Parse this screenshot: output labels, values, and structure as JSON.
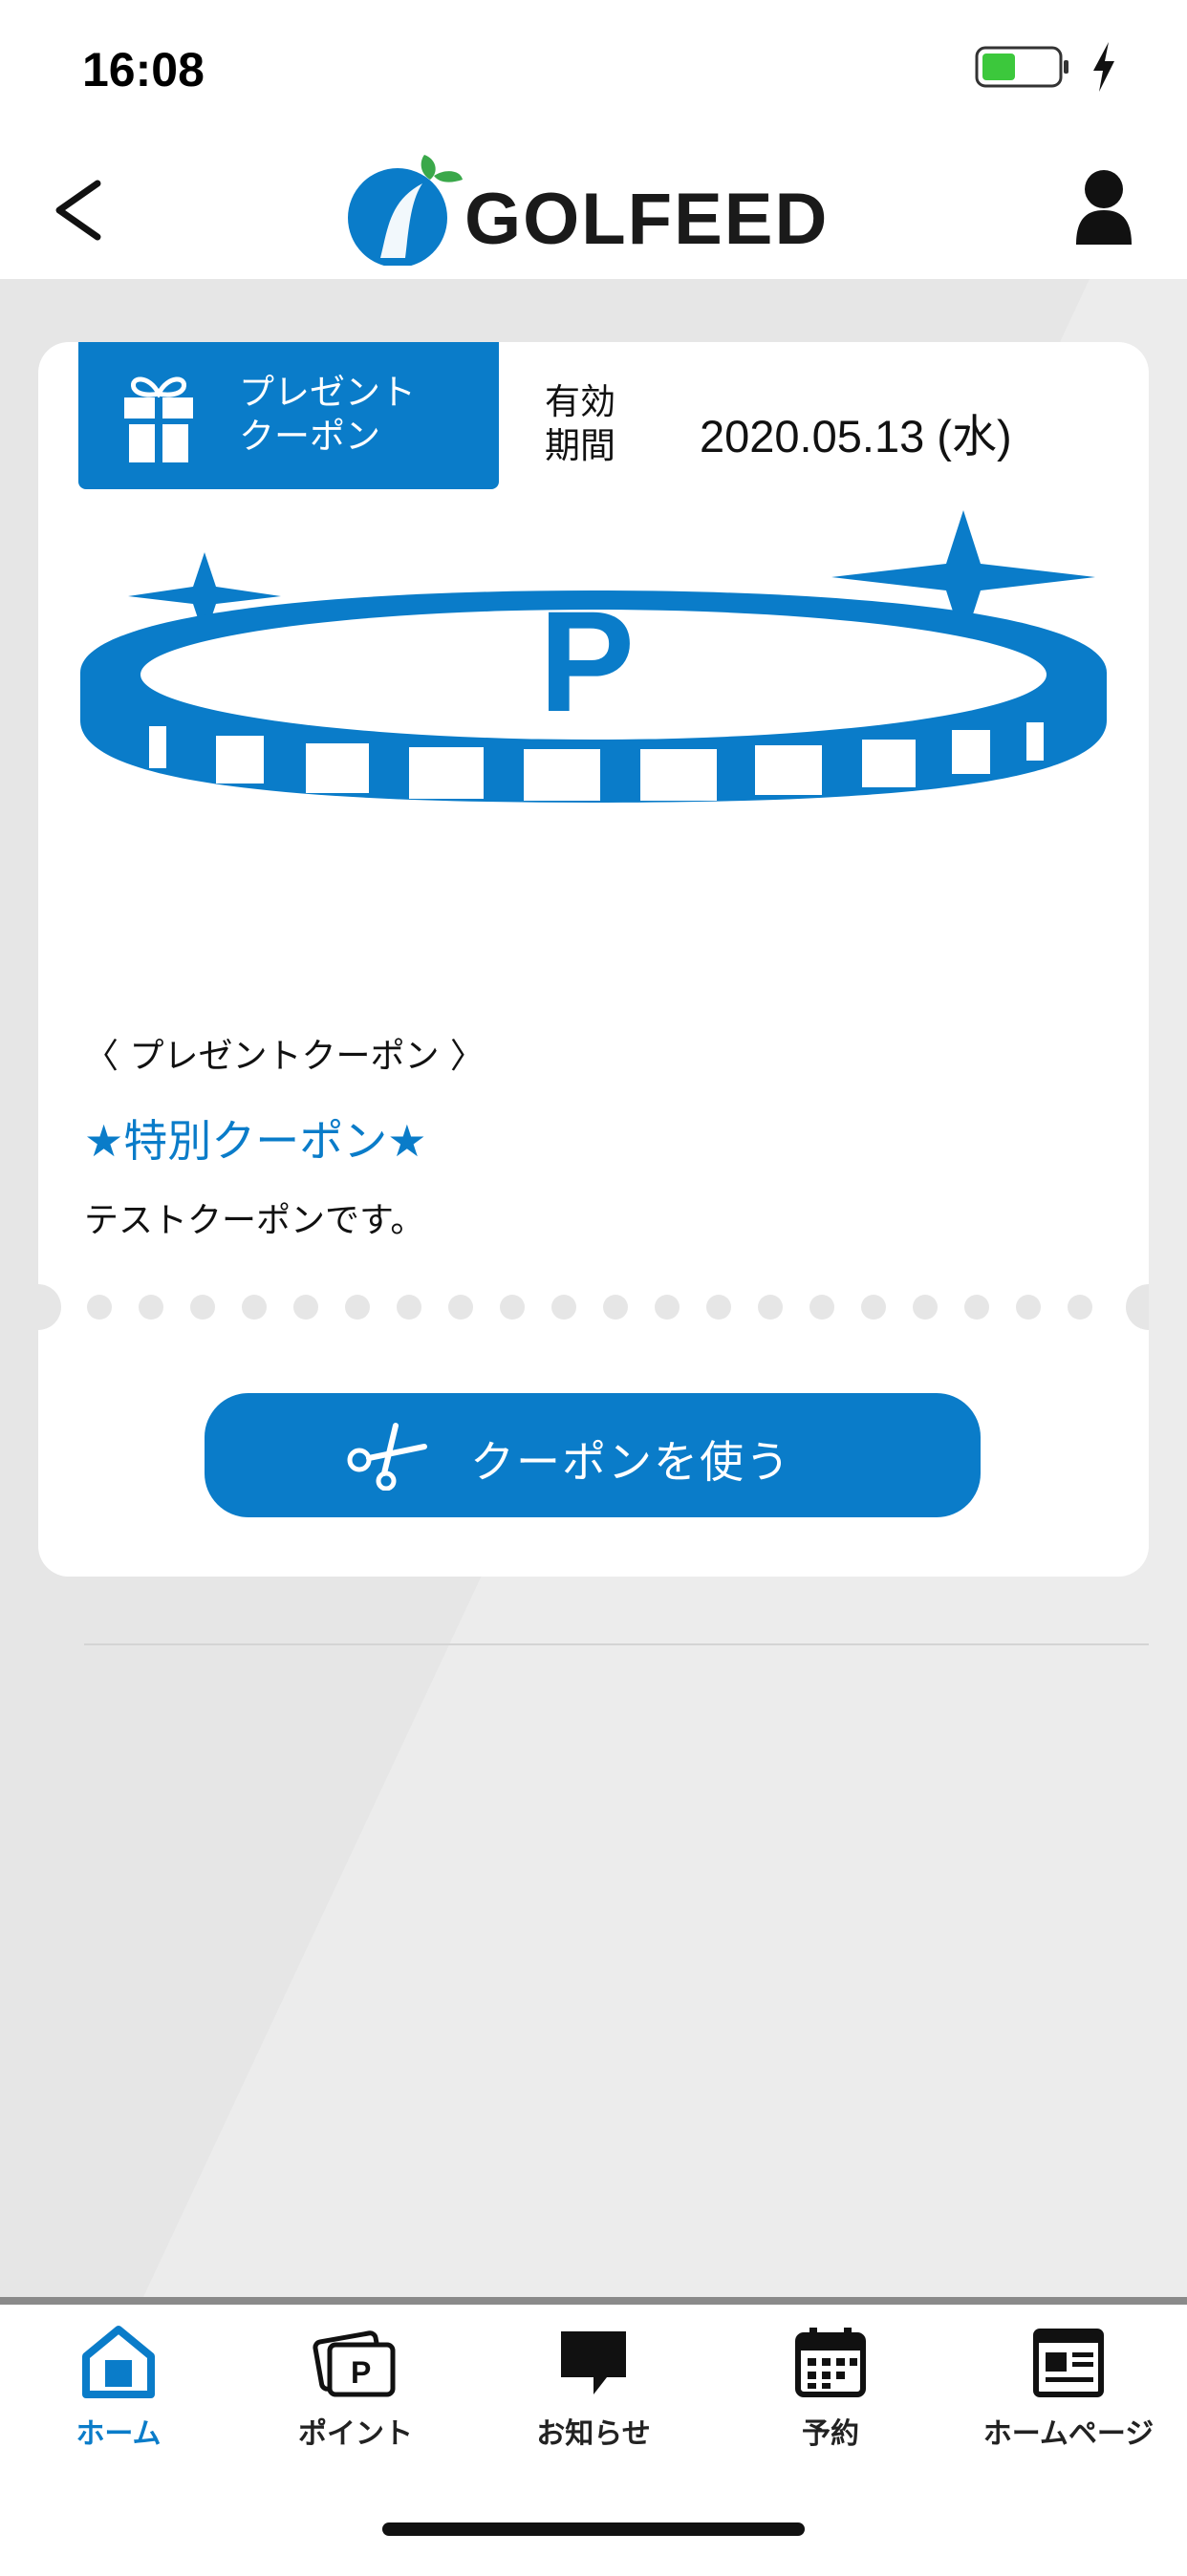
{
  "status_bar": {
    "time": "16:08",
    "battery_color": "#3cc83c"
  },
  "header": {
    "logo_text": "GOLFEED",
    "back_icon": "chevron-left-icon",
    "profile_icon": "user-icon"
  },
  "coupon": {
    "type_label_line1": "プレゼント",
    "type_label_line2": "クーポン",
    "validity_label_line1": "有効",
    "validity_label_line2": "期間",
    "validity_date": "2020.05.13 (水)",
    "image_letter": "P",
    "category": "〈 プレゼントクーポン 〉",
    "title": "★特別クーポン★",
    "description": "テストクーポンです。",
    "use_button_label": "クーポンを使う"
  },
  "tabs": [
    {
      "label": "ホーム",
      "icon": "home-icon",
      "active": true
    },
    {
      "label": "ポイント",
      "icon": "point-card-icon",
      "active": false
    },
    {
      "label": "お知らせ",
      "icon": "speech-bubble-icon",
      "active": false
    },
    {
      "label": "予約",
      "icon": "calendar-icon",
      "active": false
    },
    {
      "label": "ホームページ",
      "icon": "webpage-icon",
      "active": false
    }
  ],
  "colors": {
    "accent": "#0a7cc9",
    "background": "#e6e6e6"
  }
}
